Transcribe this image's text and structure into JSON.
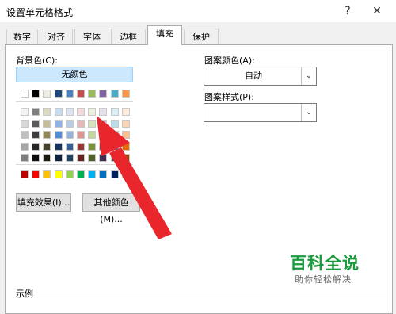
{
  "window": {
    "title": "设置单元格格式",
    "help_symbol": "?",
    "close_symbol": "✕"
  },
  "tabs": [
    "数字",
    "对齐",
    "字体",
    "边框",
    "填充",
    "保护"
  ],
  "active_tab": "填充",
  "fill": {
    "bg_color_label": "背景色(C):",
    "no_color_label": "无颜色",
    "fill_effects_button": "填充效果(I)...",
    "more_colors_button": "其他颜色(M)...",
    "pattern_color_label": "图案颜色(A):",
    "pattern_color_value": "自动",
    "pattern_style_label": "图案样式(P):",
    "pattern_style_value": ""
  },
  "palette": {
    "standard_row": [
      "#ffffff",
      "#000000",
      "#eeece1",
      "#1f497d",
      "#4f81bd",
      "#c0504d",
      "#9bbb59",
      "#8064a2",
      "#4bacc6",
      "#f79646"
    ],
    "theme_rows": [
      [
        "#f2f2f2",
        "#7f7f7f",
        "#ddd9c3",
        "#c6d9f0",
        "#dbe5f1",
        "#f2dcdb",
        "#ebf1dd",
        "#e5e0ec",
        "#dbeef3",
        "#fdeada"
      ],
      [
        "#d8d8d8",
        "#595959",
        "#c4bd97",
        "#8db3e2",
        "#b8cce4",
        "#e5b9b7",
        "#d7e3bc",
        "#ccc1d9",
        "#b7dde8",
        "#fbd5b5"
      ],
      [
        "#bfbfbf",
        "#3f3f3f",
        "#938953",
        "#548dd4",
        "#95b3d7",
        "#d99694",
        "#c3d69b",
        "#b2a2c7",
        "#92cddc",
        "#fac08f"
      ],
      [
        "#a5a5a5",
        "#262626",
        "#494429",
        "#17365d",
        "#366092",
        "#953734",
        "#76923c",
        "#5f497a",
        "#31859b",
        "#e36c09"
      ],
      [
        "#7f7f7f",
        "#0c0c0c",
        "#1d1b10",
        "#0f243e",
        "#244061",
        "#632423",
        "#4f6128",
        "#3f3151",
        "#205867",
        "#974806"
      ]
    ],
    "standard_colors": [
      "#c00000",
      "#ff0000",
      "#ffc000",
      "#ffff00",
      "#92d050",
      "#00b050",
      "#00b0f0",
      "#0070c0",
      "#002060",
      "#7030a0"
    ]
  },
  "sample": {
    "label": "示例"
  },
  "watermark": {
    "title": "百科全说",
    "subtitle": "助你轻松解决"
  },
  "annotation": {
    "arrow_color": "#e8262b"
  }
}
